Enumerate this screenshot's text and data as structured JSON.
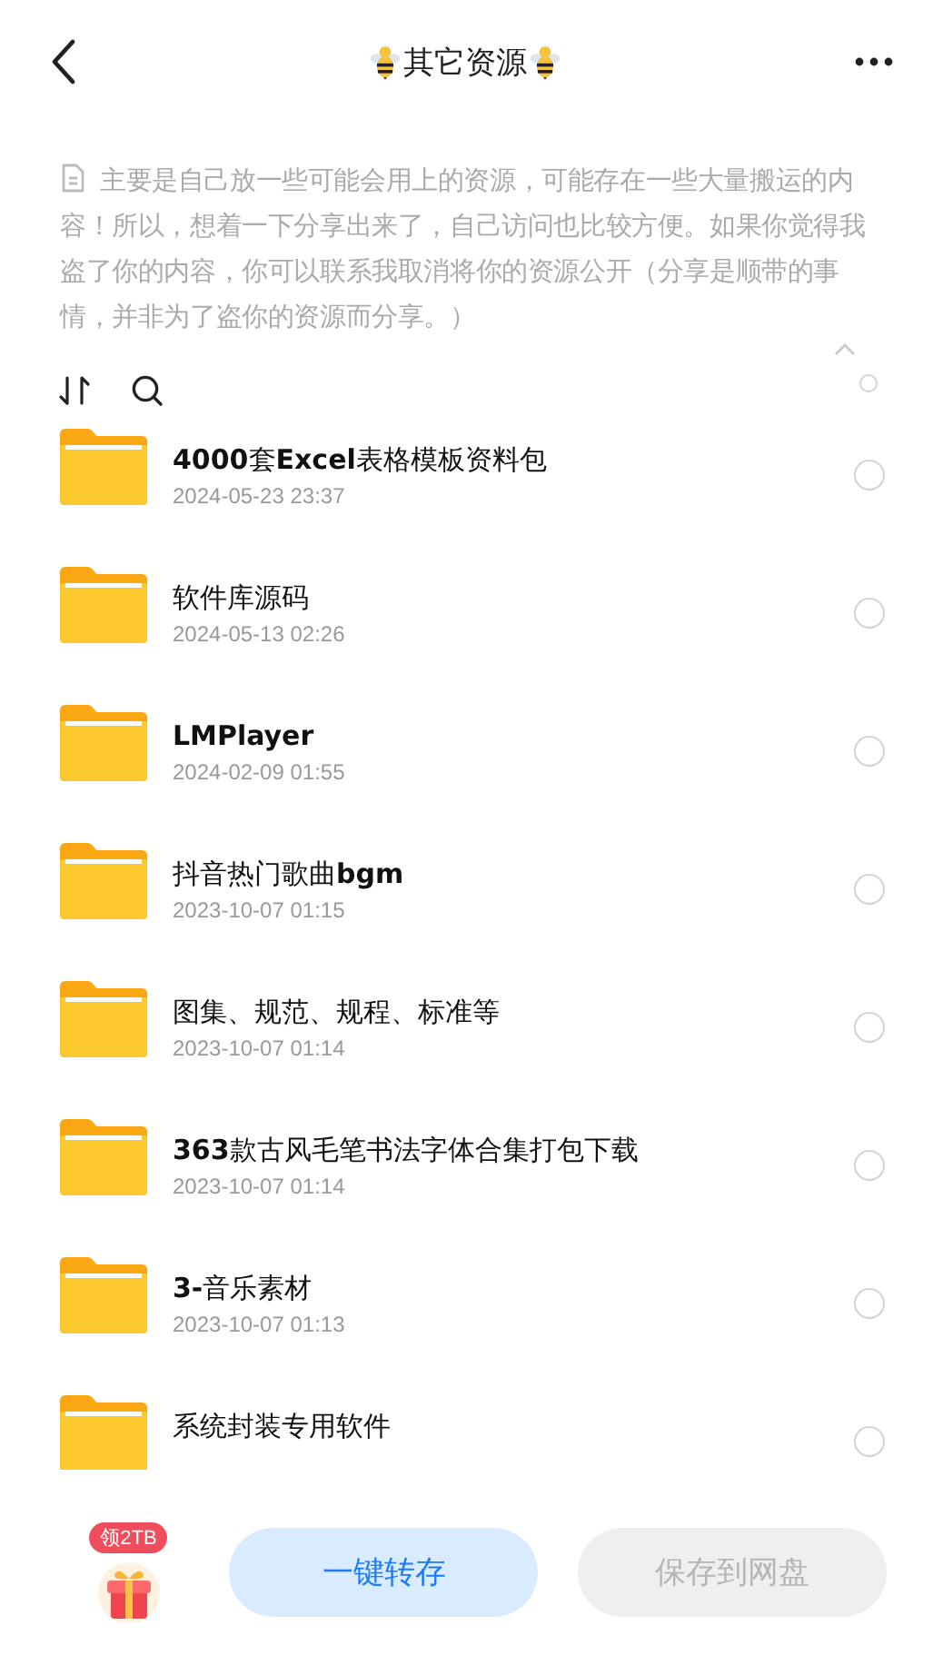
{
  "header": {
    "title": "其它资源"
  },
  "description": {
    "text": "主要是自己放一些可能会用上的资源，可能存在一些大量搬运的内容！所以，想着一下分享出来了，自己访问也比较方便。如果你觉得我盗了你的内容，你可以联系我取消将你的资源公开（分享是顺带的事情，并非为了盗你的资源而分享。）",
    "expanded": true
  },
  "toolbar": {
    "select_all": false
  },
  "files": [
    {
      "name": "**4000**套**Excel**表格模板资料包",
      "date": "2024-05-23 23:37",
      "selected": false
    },
    {
      "name": "软件库源码",
      "date": "2024-05-13 02:26",
      "selected": false
    },
    {
      "name": "**LMPlayer**",
      "date": "2024-02-09 01:55",
      "selected": false
    },
    {
      "name": "抖音热门歌曲**bgm**",
      "date": "2023-10-07 01:15",
      "selected": false
    },
    {
      "name": "图集、规范、规程、标准等",
      "date": "2023-10-07 01:14",
      "selected": false
    },
    {
      "name": "**363**款古风毛笔书法字体合集打包下载",
      "date": "2023-10-07 01:14",
      "selected": false
    },
    {
      "name": "**3-**音乐素材",
      "date": "2023-10-07 01:13",
      "selected": false
    },
    {
      "name": "系统封装专用软件",
      "selected": false
    }
  ],
  "bottom": {
    "badge": "领2TB",
    "buttons": [
      {
        "label": "一键转存",
        "disabled": false
      },
      {
        "label": "保存到网盘",
        "disabled": true
      }
    ]
  }
}
